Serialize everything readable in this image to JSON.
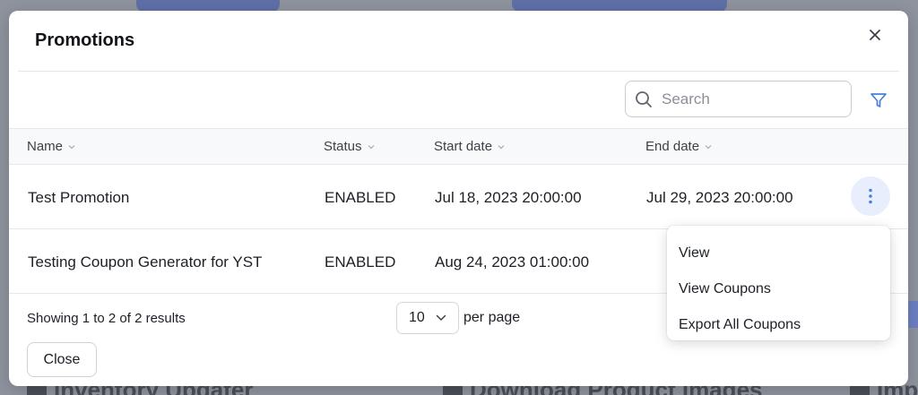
{
  "modal": {
    "title": "Promotions"
  },
  "search": {
    "placeholder": "Search",
    "value": ""
  },
  "table": {
    "columns": [
      "Name",
      "Status",
      "Start date",
      "End date"
    ],
    "rows": [
      {
        "name": "Test Promotion",
        "status": "ENABLED",
        "start_date": "Jul 18, 2023 20:00:00",
        "end_date": "Jul 29, 2023 20:00:00"
      },
      {
        "name": "Testing Coupon Generator for YST",
        "status": "ENABLED",
        "start_date": "Aug 24, 2023 01:00:00",
        "end_date": ""
      }
    ]
  },
  "row_menu": {
    "items": [
      "View",
      "View Coupons",
      "Export All Coupons"
    ]
  },
  "pagination": {
    "summary": "Showing 1 to 2 of 2 results",
    "per_page_value": "10",
    "per_page_label": "per page"
  },
  "footer": {
    "close_label": "Close"
  },
  "background": {
    "bottom_left": "Inventory Updater",
    "bottom_middle": "Download Product Images",
    "bottom_right": "Imp"
  },
  "icons": {
    "close": "close-icon",
    "search": "search-icon",
    "filter": "filter-icon",
    "sort": "chevron-down-icon",
    "kebab": "more-vertical-icon"
  },
  "colors": {
    "accent": "#4a7fe0",
    "kebab_bg": "#e8eefb",
    "overlay": "#8e939d"
  }
}
